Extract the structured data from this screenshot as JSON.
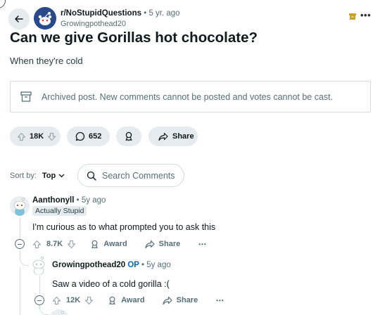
{
  "post": {
    "subreddit": "r/NoStupidQuestions",
    "separator": "•",
    "age": "5 yr. ago",
    "author": "Growingpothead20",
    "title": "Can we give Gorillas hot chocolate?",
    "body": "When they're cold",
    "more": "•••"
  },
  "archived_notice": "Archived post. New comments cannot be posted and votes cannot be cast.",
  "actions": {
    "votes": "18K",
    "comments": "652",
    "share": "Share"
  },
  "sort": {
    "label": "Sort by:",
    "value": "Top",
    "search_placeholder": "Search Comments"
  },
  "comments": [
    {
      "author": "Aanthonyll",
      "separator": "•",
      "age": "5y ago",
      "flair": "Actually Stupid",
      "body": "I'm curious as to what prompted you to ask this",
      "votes": "8.7K",
      "award": "Award",
      "share": "Share",
      "more": "•••"
    },
    {
      "author": "Growingpothead20",
      "op": "OP",
      "separator": "•",
      "age": "5y ago",
      "body": "Saw a video of a cold gorilla :(",
      "votes": "12K",
      "award": "Award",
      "share": "Share",
      "more": "•••"
    }
  ],
  "colors": {
    "pill_bg": "#e5ebee",
    "muted_text": "#576f76",
    "op_blue": "#0a66c2",
    "archive_badge": "#c9a227"
  }
}
